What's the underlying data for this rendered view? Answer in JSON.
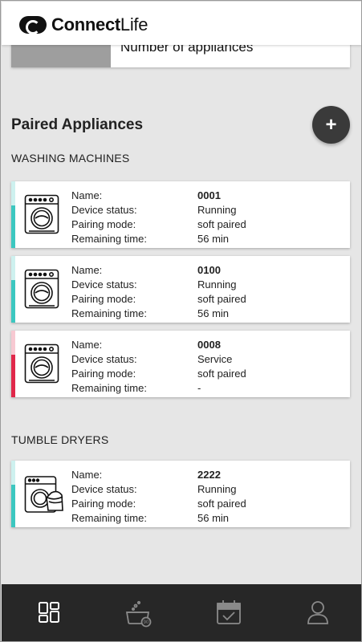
{
  "app": {
    "brand_bold": "Connect",
    "brand_light": "Life"
  },
  "summary": {
    "label": "Number of appliances"
  },
  "paired": {
    "title": "Paired Appliances",
    "add_icon": "plus-icon"
  },
  "field_labels": {
    "name": "Name:",
    "status": "Device status:",
    "pairing": "Pairing mode:",
    "remaining": "Remaining time:"
  },
  "washing_machines": {
    "title": "WASHING MACHINES",
    "items": [
      {
        "name": "0001",
        "status": "Running",
        "pairing": "soft paired",
        "remaining": "56 min",
        "color": "#3cc7c0",
        "icon": "washing-machine-icon"
      },
      {
        "name": "0100",
        "status": "Running",
        "pairing": "soft paired",
        "remaining": "56 min",
        "color": "#3cc7c0",
        "icon": "washing-machine-icon"
      },
      {
        "name": "0008",
        "status": "Service",
        "pairing": "soft paired",
        "remaining": "-",
        "color": "#e0284a",
        "icon": "washing-machine-icon"
      }
    ]
  },
  "tumble_dryers": {
    "title": "TUMBLE DRYERS",
    "items": [
      {
        "name": "2222",
        "status": "Running",
        "pairing": "soft paired",
        "remaining": "56 min",
        "color": "#3cc7c0",
        "icon": "tumble-dryer-icon"
      }
    ]
  },
  "nav": {
    "items": [
      {
        "icon": "dashboard-icon",
        "active": true
      },
      {
        "icon": "wash-program-icon",
        "active": false
      },
      {
        "icon": "calendar-icon",
        "active": false
      },
      {
        "icon": "profile-icon",
        "active": false
      }
    ],
    "active_color": "#ffffff",
    "inactive_color": "#8a8a8a"
  }
}
